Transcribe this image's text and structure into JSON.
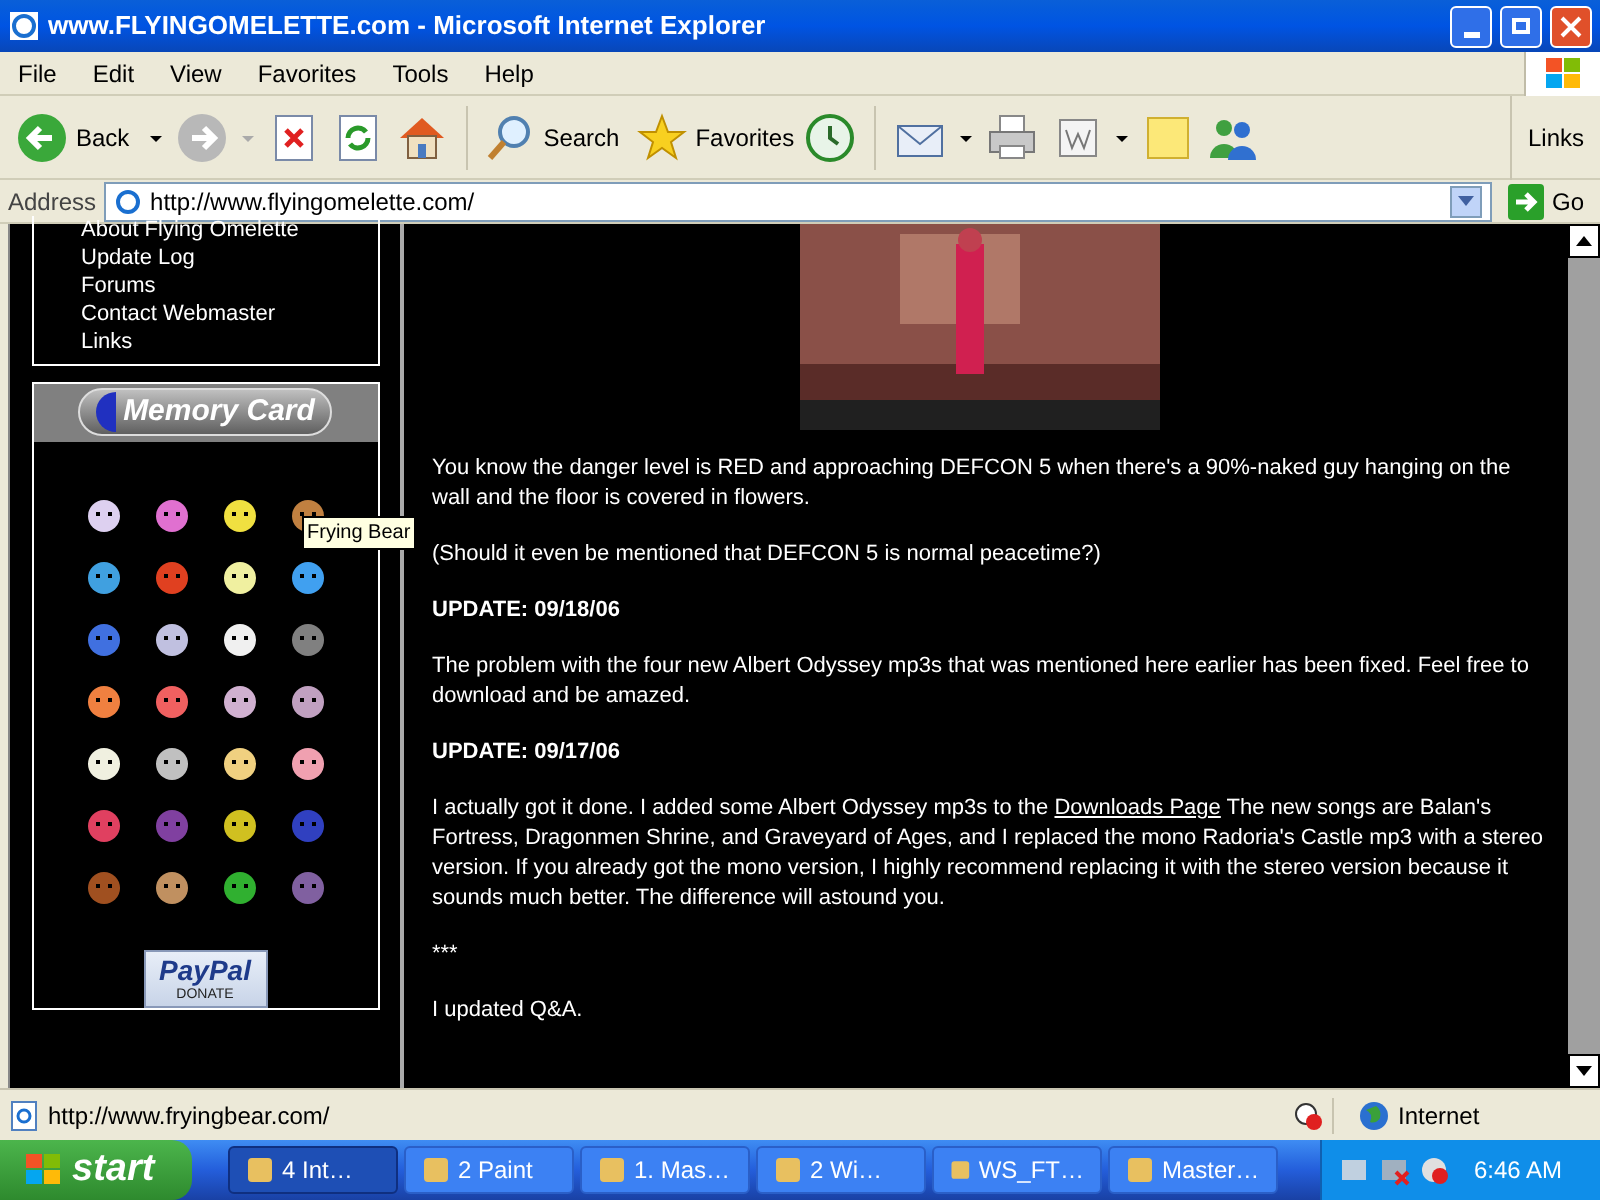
{
  "window": {
    "title": "www.FLYINGOMELETTE.com - Microsoft Internet Explorer"
  },
  "menu": [
    "File",
    "Edit",
    "View",
    "Favorites",
    "Tools",
    "Help"
  ],
  "toolbar": {
    "back": "Back",
    "search": "Search",
    "favorites": "Favorites",
    "links": "Links"
  },
  "address": {
    "label": "Address",
    "value": "http://www.flyingomelette.com/",
    "go": "Go"
  },
  "sidebar": {
    "links": [
      "About Flying Omelette",
      "Update Log",
      "Forums",
      "Contact Webmaster",
      "Links"
    ],
    "memory_card": {
      "title": "Memory Card",
      "tooltip": "Frying Bear",
      "donate": {
        "brand": "PayPal",
        "label": "DONATE"
      }
    }
  },
  "content": [
    {
      "kind": "paragraph",
      "text": "You know the danger level is RED and approaching DEFCON 5 when there's a 90%-naked guy hanging on the wall and the floor is covered in flowers."
    },
    {
      "kind": "paragraph",
      "text": "(Should it even be mentioned that DEFCON 5 is normal peacetime?)"
    },
    {
      "kind": "heading",
      "text": "UPDATE: 09/18/06"
    },
    {
      "kind": "paragraph",
      "text": "The problem with the four new Albert Odyssey mp3s that was mentioned here earlier has been fixed. Feel free to download and be amazed."
    },
    {
      "kind": "heading",
      "text": "UPDATE: 09/17/06"
    },
    {
      "kind": "link_paragraph",
      "before": "I actually got it done. I added some Albert Odyssey mp3s to the",
      "link": "Downloads Page",
      "after": "The new songs are Balan's Fortress, Dragonmen Shrine, and Graveyard of Ages, and I replaced the mono Radoria's Castle mp3 with a stereo version. If you already got the mono version, I highly recommend replacing it with the stereo version because it sounds much better. The difference will astound you."
    },
    {
      "kind": "paragraph",
      "text": "***"
    },
    {
      "kind": "paragraph",
      "text": "I updated Q&A."
    }
  ],
  "status_bar": {
    "url": "http://www.fryingbear.com/",
    "zone": "Internet"
  },
  "taskbar": {
    "start": "start",
    "buttons": [
      {
        "label": "4 Int…",
        "selected": true
      },
      {
        "label": "2 Paint",
        "selected": false
      },
      {
        "label": "1. Mas…",
        "selected": false
      },
      {
        "label": "2 Wi…",
        "selected": false
      },
      {
        "label": "WS_FT…",
        "selected": false
      },
      {
        "label": "Master…",
        "selected": false
      }
    ],
    "clock": "6:46 AM"
  }
}
